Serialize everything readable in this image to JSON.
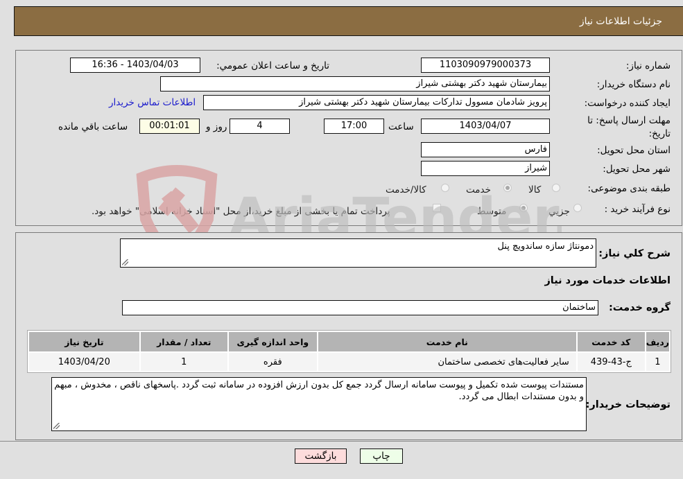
{
  "header": {
    "title": "جزئیات اطلاعات نیاز"
  },
  "details": {
    "need_number": {
      "label": "شماره نیاز:",
      "value": "1103090979000373"
    },
    "announce_datetime": {
      "label": "تاریخ و ساعت اعلان عمومي:",
      "value": "1403/04/03 - 16:36"
    },
    "buyer_org": {
      "label": "نام دستگاه خريدار:",
      "value": "بیمارستان شهید دکتر بهشتی شیراز"
    },
    "requester": {
      "label": "ایجاد کننده درخواست:",
      "value": "پرویز شادمان مسوول تدارکات بیمارستان شهید دکتر بهشتی شیراز"
    },
    "buyer_contact_link": "اطلاعات تماس خريدار",
    "deadline": {
      "label": "مهلت ارسال پاسخ: تا تاریخ:",
      "date": "1403/04/07",
      "time_label": "ساعت",
      "time": "17:00",
      "days": "4",
      "days_label": "روز و",
      "remaining": "00:01:01",
      "remaining_label": "ساعت باقي مانده"
    },
    "province": {
      "label": "استان محل تحویل:",
      "value": "فارس"
    },
    "city": {
      "label": "شهر محل تحویل:",
      "value": "شیراز"
    },
    "category": {
      "label": "طبقه بندی موضوعی:",
      "options": [
        {
          "label": "کالا",
          "checked": false
        },
        {
          "label": "خدمت",
          "checked": true
        },
        {
          "label": "کالا/خدمت",
          "checked": false
        }
      ]
    },
    "purchase_type": {
      "label": "نوع فرآیند خرید :",
      "options": [
        {
          "label": "جزيي",
          "checked": false
        },
        {
          "label": "متوسط",
          "checked": true
        }
      ],
      "treasury_note": "پرداخت تمام یا بخشی از مبلغ خرید،از محل \"اسناد خزانه اسلامی\" خواهد بود.",
      "treasury_checked": false
    }
  },
  "services": {
    "summary_label": "شرح کلي نياز:",
    "summary_value": "دمونتاژ سازه ساندویچ پنل",
    "section_title": "اطلاعات خدمات مورد نیاز",
    "group_label": "گروه خدمت:",
    "group_value": "ساختمان",
    "table": {
      "headers": [
        "ردیف",
        "کد خدمت",
        "نام خدمت",
        "واحد اندازه گیری",
        "تعداد / مقدار",
        "تاریخ نیاز"
      ],
      "rows": [
        [
          "1",
          "ج-43-439",
          "سایر فعالیت‌های تخصصی ساختمان",
          "فقره",
          "1",
          "1403/04/20"
        ]
      ]
    },
    "buyer_notes_label": "توضیحات خریدار:",
    "buyer_notes": "مستندات پیوست  شده تکمیل و پیوست سامانه ارسال گردد جمع کل بدون ارزش افزوده در سامانه ثبت گردد .پاسخهای ناقص ، مخدوش ، مبهم و بدون مستندات ابطال می گردد."
  },
  "buttons": {
    "print": "چاپ",
    "back": "بازگشت"
  },
  "watermark": {
    "text": "AriaTender.neT"
  }
}
